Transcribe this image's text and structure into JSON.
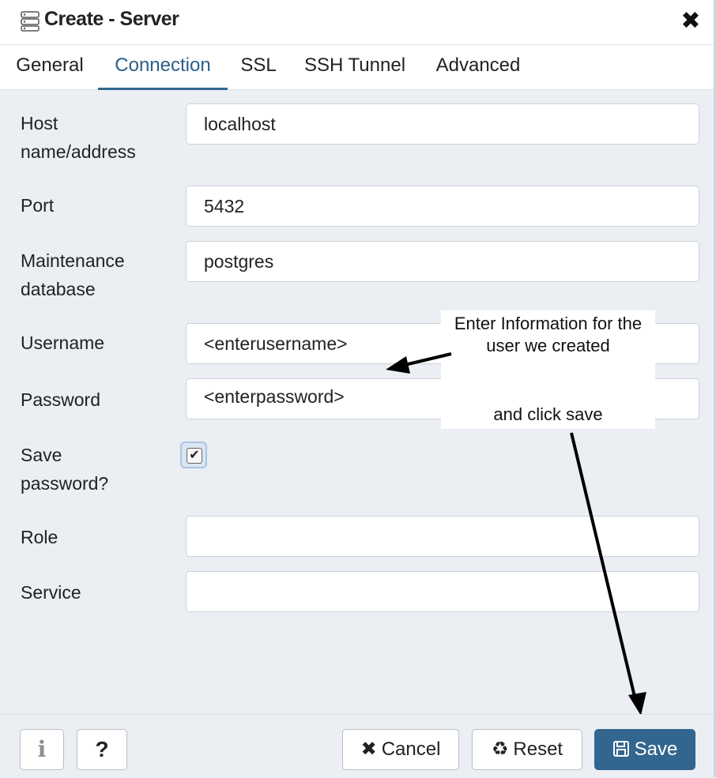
{
  "dialog": {
    "title": "Create - Server",
    "close_symbol": "✖"
  },
  "tabs": [
    {
      "label": "General"
    },
    {
      "label": "Connection"
    },
    {
      "label": "SSL"
    },
    {
      "label": "SSH Tunnel"
    },
    {
      "label": "Advanced"
    }
  ],
  "active_tab": "Connection",
  "form": {
    "host": {
      "label_line1": "Host",
      "label_line2": "name/address",
      "value": "localhost"
    },
    "port": {
      "label": "Port",
      "value": "5432"
    },
    "maintenance_db": {
      "label_line1": "Maintenance",
      "label_line2": "database",
      "value": "postgres"
    },
    "username": {
      "label": "Username",
      "value": "<enterusername>"
    },
    "password": {
      "label": "Password",
      "value": "<enterpassword>"
    },
    "save_password": {
      "label_line1": "Save",
      "label_line2": "password?",
      "checked": true,
      "check_mark": "✔"
    },
    "role": {
      "label": "Role",
      "value": ""
    },
    "service": {
      "label": "Service",
      "value": ""
    }
  },
  "annotation": {
    "line1": "Enter Information for the",
    "line2": "user we created",
    "line3": "and click save"
  },
  "footer": {
    "info_symbol": "i",
    "help_symbol": "?",
    "cancel": {
      "icon": "✖",
      "label": "Cancel"
    },
    "reset": {
      "icon": "♻",
      "label": "Reset"
    },
    "save": {
      "icon": "💾",
      "label": "Save"
    }
  },
  "colors": {
    "accent": "#326690",
    "content_bg": "#ebeef3",
    "annotation_arrow": "#000000"
  }
}
